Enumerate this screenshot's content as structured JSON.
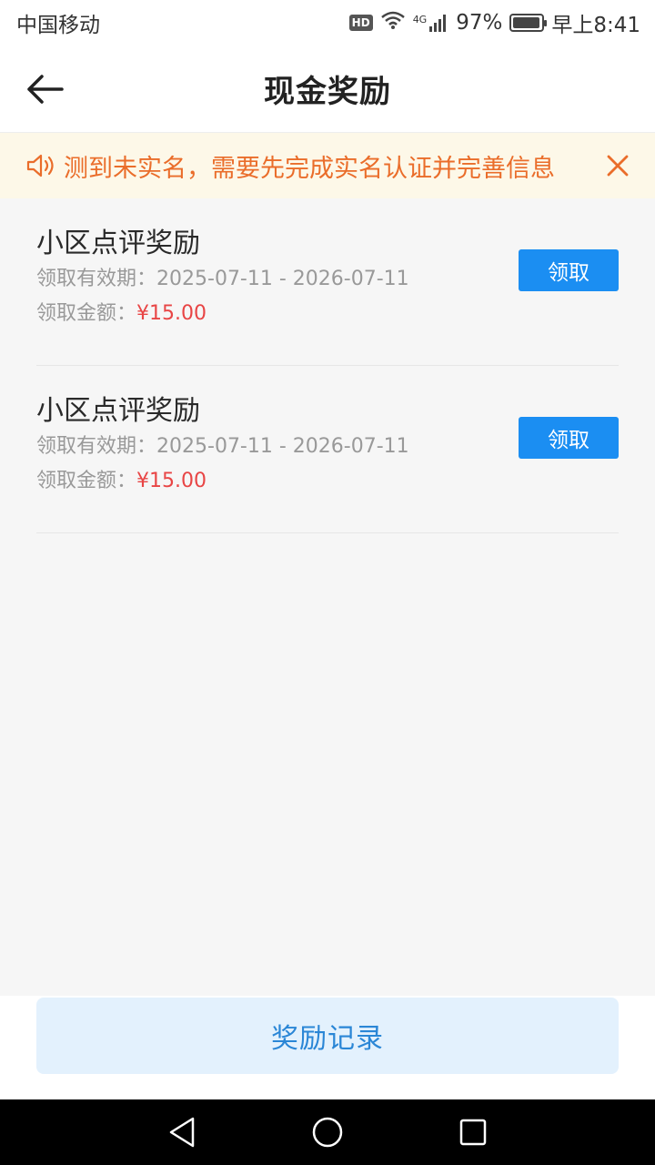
{
  "status_bar": {
    "carrier": "中国移动",
    "hd": "HD",
    "network": "4G",
    "battery": "97%",
    "battery_level": 0.97,
    "time": "早上8:41"
  },
  "header": {
    "title": "现金奖励"
  },
  "notice": {
    "text": "测到未实名，需要先完成实名认证并完善信息",
    "color": "#ea6d2a"
  },
  "rewards": [
    {
      "title": "小区点评奖励",
      "validity_label": "领取有效期：",
      "validity": "2025-07-11 - 2026-07-11",
      "amount_label": "领取金额：",
      "amount": "¥15.00",
      "button": "领取"
    },
    {
      "title": "小区点评奖励",
      "validity_label": "领取有效期：",
      "validity": "2025-07-11 - 2026-07-11",
      "amount_label": "领取金额：",
      "amount": "¥15.00",
      "button": "领取"
    }
  ],
  "bottom": {
    "records_label": "奖励记录"
  },
  "colors": {
    "accent": "#1b8ef2",
    "amount": "#e84545",
    "records_bg": "#e3f1fd"
  }
}
